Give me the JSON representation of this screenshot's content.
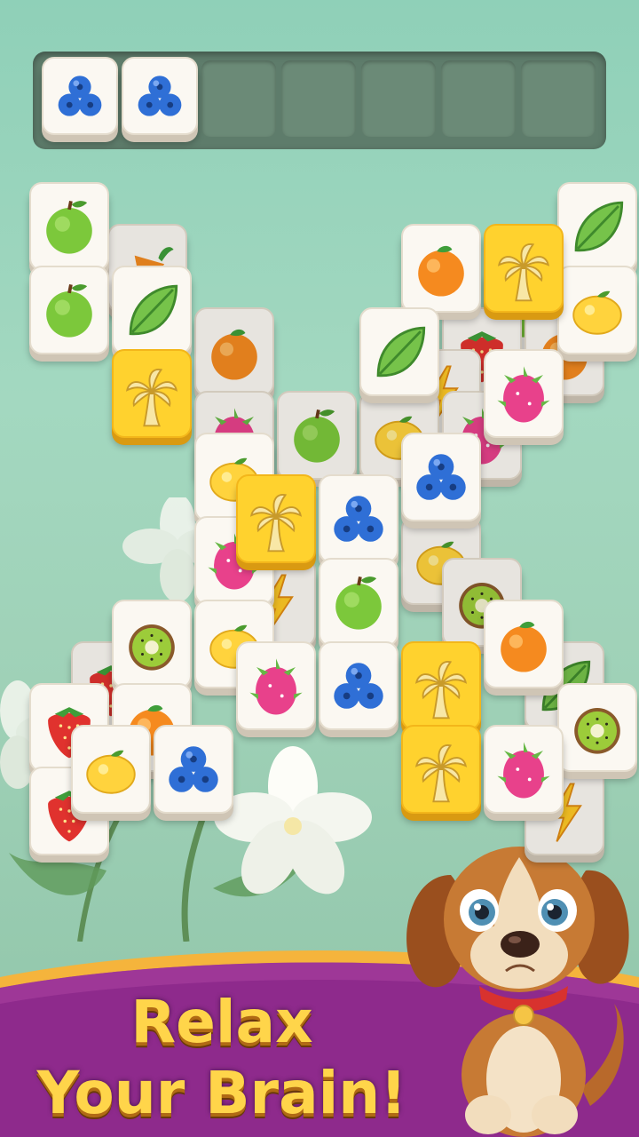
{
  "tray": {
    "slots": 7,
    "filled": [
      {
        "icon": "blueberry-icon"
      },
      {
        "icon": "blueberry-icon"
      }
    ]
  },
  "board": {
    "tiles": [
      {
        "icon": "apple-icon",
        "col": 0,
        "row": 0,
        "layer": 0
      },
      {
        "icon": "carrot-icon",
        "col": 0.95,
        "row": 0.5,
        "layer": -1
      },
      {
        "icon": "apple-icon",
        "col": 0,
        "row": 1,
        "layer": 0
      },
      {
        "icon": "leaf-icon",
        "col": 1,
        "row": 1,
        "layer": 0
      },
      {
        "icon": "orange-icon",
        "col": 2,
        "row": 1.5,
        "layer": -1
      },
      {
        "icon": "palm-icon",
        "col": 1,
        "row": 2,
        "layer": 1,
        "special": true
      },
      {
        "icon": "dragonfruit-icon",
        "col": 2,
        "row": 2.5,
        "layer": -1
      },
      {
        "icon": "apple-icon",
        "col": 3,
        "row": 2.5,
        "layer": -1
      },
      {
        "icon": "lemon-icon",
        "col": 2,
        "row": 3,
        "layer": 0
      },
      {
        "icon": "leaf-icon",
        "col": 4,
        "row": 1.5,
        "layer": 0
      },
      {
        "icon": "lightning-icon",
        "col": 4.5,
        "row": 2,
        "layer": -1
      },
      {
        "icon": "lemon-icon",
        "col": 4,
        "row": 2.5,
        "layer": -1
      },
      {
        "icon": "blueberry-icon",
        "col": 4.5,
        "row": 3,
        "layer": 0
      },
      {
        "icon": "palm-icon",
        "col": 2.5,
        "row": 3.5,
        "layer": 1,
        "special": true
      },
      {
        "icon": "blueberry-icon",
        "col": 3.5,
        "row": 3.5,
        "layer": 1
      },
      {
        "icon": "dragonfruit-icon",
        "col": 2,
        "row": 4,
        "layer": 0
      },
      {
        "icon": "lemon-icon",
        "col": 4.5,
        "row": 4,
        "layer": -1
      },
      {
        "icon": "lightning-icon",
        "col": 2.5,
        "row": 4.5,
        "layer": -1
      },
      {
        "icon": "apple-icon",
        "col": 3.5,
        "row": 4.5,
        "layer": 1
      },
      {
        "icon": "kiwi-icon",
        "col": 5,
        "row": 4.5,
        "layer": -1
      },
      {
        "icon": "kiwi-icon",
        "col": 1,
        "row": 5,
        "layer": 0
      },
      {
        "icon": "lemon-icon",
        "col": 2,
        "row": 5,
        "layer": 0
      },
      {
        "icon": "orange-icon",
        "col": 5.5,
        "row": 5,
        "layer": 0
      },
      {
        "icon": "strawberry-icon",
        "col": 0.5,
        "row": 5.5,
        "layer": -1
      },
      {
        "icon": "dragonfruit-icon",
        "col": 2.5,
        "row": 5.5,
        "layer": 1
      },
      {
        "icon": "blueberry-icon",
        "col": 3.5,
        "row": 5.5,
        "layer": 1
      },
      {
        "icon": "palm-icon",
        "col": 4.5,
        "row": 5.5,
        "layer": 1,
        "special": true
      },
      {
        "icon": "leaf-icon",
        "col": 6,
        "row": 5.5,
        "layer": -1
      },
      {
        "icon": "strawberry-icon",
        "col": 0,
        "row": 6,
        "layer": 0
      },
      {
        "icon": "orange-icon",
        "col": 1,
        "row": 6,
        "layer": 0
      },
      {
        "icon": "kiwi-icon",
        "col": 6.5,
        "row": 6,
        "layer": 0
      },
      {
        "icon": "lemon-icon",
        "col": 0.5,
        "row": 6.5,
        "layer": 1
      },
      {
        "icon": "blueberry-icon",
        "col": 1.5,
        "row": 6.5,
        "layer": 1
      },
      {
        "icon": "palm-icon",
        "col": 4.5,
        "row": 6.5,
        "layer": 1,
        "special": true
      },
      {
        "icon": "dragonfruit-icon",
        "col": 5.5,
        "row": 6.5,
        "layer": 1
      },
      {
        "icon": "strawberry-icon",
        "col": 0,
        "row": 7,
        "layer": 0
      },
      {
        "icon": "lightning-icon",
        "col": 6,
        "row": 7,
        "layer": -1
      },
      {
        "icon": "leaf-icon",
        "col": 6.5,
        "row": 0,
        "layer": 0
      },
      {
        "icon": "orange-icon",
        "col": 4.5,
        "row": 0.5,
        "layer": 0
      },
      {
        "icon": "palm-icon",
        "col": 5.5,
        "row": 0.5,
        "layer": 1,
        "special": true
      },
      {
        "icon": "lemon-icon",
        "col": 6.5,
        "row": 1,
        "layer": 0
      },
      {
        "icon": "apple-icon",
        "col": 5.5,
        "row": 1,
        "layer": -1
      },
      {
        "icon": "strawberry-icon",
        "col": 5,
        "row": 1.5,
        "layer": -1
      },
      {
        "icon": "orange-icon",
        "col": 6,
        "row": 1.5,
        "layer": -1
      },
      {
        "icon": "dragonfruit-icon",
        "col": 5.5,
        "row": 2,
        "layer": 0
      },
      {
        "icon": "dragonfruit-icon",
        "col": 5,
        "row": 2.5,
        "layer": -1
      }
    ]
  },
  "banner": {
    "line1": "Relax",
    "line2": "Your Brain!"
  },
  "mascot": {
    "icon": "puppy-mascot"
  },
  "colors": {
    "background": "#9fd6bd",
    "tray": "#5e7c6b",
    "tile": "#fbf8f2",
    "special_tile": "#ffd22e",
    "banner_purple": "#8e2a8c",
    "banner_gold": "#f5b43c",
    "title_text": "#ffd54a"
  }
}
